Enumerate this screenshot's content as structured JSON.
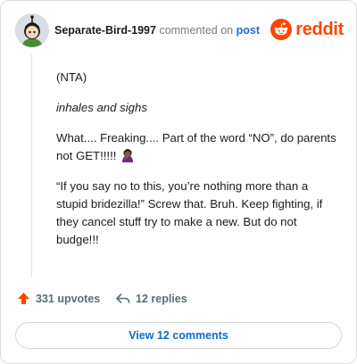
{
  "header": {
    "username": "Separate-Bird-1997",
    "commented_text": "commented on",
    "post_link": "post",
    "logo_text": "reddit"
  },
  "comment": {
    "paragraphs": [
      "(NTA)",
      "inhales and sighs",
      "What.... Freaking.... Part of the word “NO”, do parents not GET!!!!!",
      "“If you say no to this, you’re nothing more than a stupid bridezilla!” Screw that. Bruh. Keep fighting, if they cancel stuff try to make a new. But do not budge!!!"
    ],
    "emoji": "woman-facepalming-icon"
  },
  "actions": {
    "upvotes": "331 upvotes",
    "replies": "12 replies"
  },
  "view_button": "View 12 comments",
  "colors": {
    "brand": "#ff4500",
    "link": "#1a6fd1",
    "upvote": "#ff4500"
  }
}
